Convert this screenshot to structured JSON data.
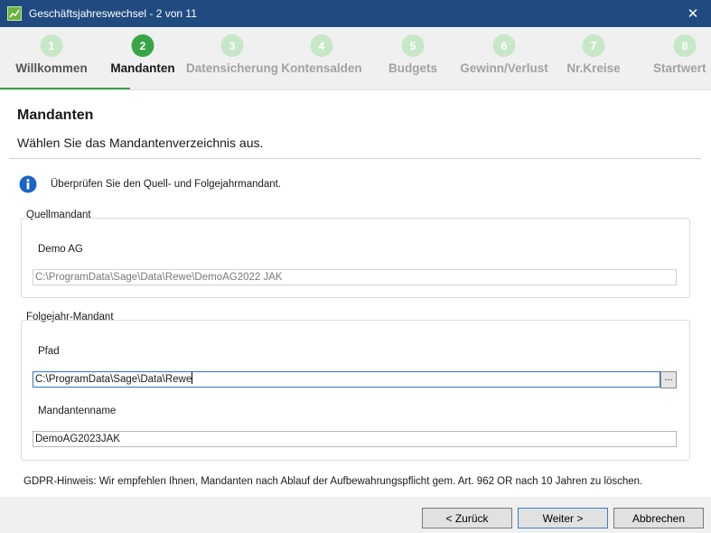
{
  "window": {
    "title": "Geschäftsjahreswechsel - 2 von 11",
    "close_glyph": "✕"
  },
  "steps": [
    {
      "number": "1",
      "label": "Willkommen",
      "state": "done"
    },
    {
      "number": "2",
      "label": "Mandanten",
      "state": "active"
    },
    {
      "number": "3",
      "label": "Datensicherung",
      "state": "pending"
    },
    {
      "number": "4",
      "label": "Kontensalden",
      "state": "pending"
    },
    {
      "number": "5",
      "label": "Budgets",
      "state": "pending"
    },
    {
      "number": "6",
      "label": "Gewinn/Verlust",
      "state": "pending"
    },
    {
      "number": "7",
      "label": "Nr.Kreise",
      "state": "pending"
    },
    {
      "number": "8",
      "label": "Startwert",
      "state": "pending"
    }
  ],
  "page": {
    "title": "Mandanten",
    "subtitle": "Wählen Sie das Mandantenverzeichnis aus."
  },
  "info": {
    "icon": "info-icon",
    "text": "Überprüfen Sie den Quell- und Folgejahrmandant."
  },
  "source": {
    "group_label": "Quellmandant",
    "name": "Demo AG",
    "path": "C:\\ProgramData\\Sage\\Data\\Rewe\\DemoAG2022 JAK"
  },
  "target": {
    "group_label": "Folgejahr-Mandant",
    "path_label": "Pfad",
    "path_value": "C:\\ProgramData\\Sage\\Data\\Rewe",
    "browse_label": "...",
    "name_label": "Mandantenname",
    "name_value": "DemoAG2023JAK"
  },
  "gdpr_note": "GDPR-Hinweis: Wir empfehlen Ihnen, Mandanten nach Ablauf der Aufbewahrungspflicht  gem. Art. 962 OR nach 10 Jahren zu löschen.",
  "buttons": {
    "back": "< Zurück",
    "next": "Weiter >",
    "cancel": "Abbrechen"
  },
  "colors": {
    "titlebar": "#1f4b80",
    "accent_green": "#3aa548",
    "pending_green": "#c7e8c7"
  }
}
